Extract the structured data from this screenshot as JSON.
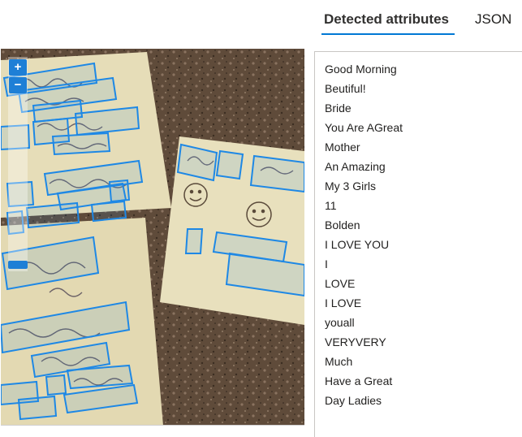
{
  "tabs": {
    "detected_label": "Detected attributes",
    "json_label": "JSON",
    "active": "detected"
  },
  "zoom": {
    "in_label": "+",
    "out_label": "−",
    "level": 0
  },
  "image": {
    "subject": "handwritten sticky notes on granite countertop"
  },
  "attributes": [
    "Good Morning",
    "Beutiful!",
    "Bride",
    "You Are AGreat",
    "Mother",
    "An Amazing",
    "My 3 Girls",
    "11",
    "Bolden",
    "I LOVE YOU",
    "I",
    "LOVE",
    "I LOVE",
    "youall",
    "VERYVERY",
    "Much",
    "Have a Great",
    "Day Ladies"
  ],
  "colors": {
    "accent": "#0078d4",
    "box": "#1e88e5",
    "zoom_button": "#1e7fd6"
  }
}
